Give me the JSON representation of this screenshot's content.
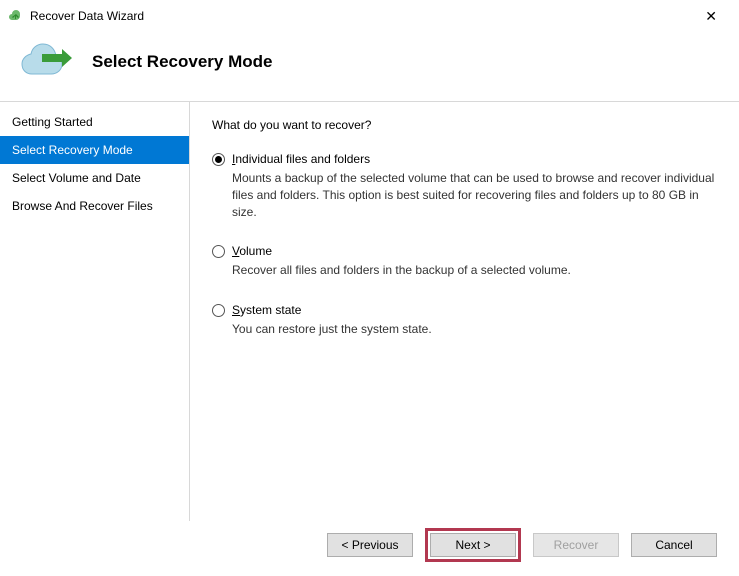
{
  "window": {
    "title": "Recover Data Wizard"
  },
  "header": {
    "title": "Select Recovery Mode"
  },
  "sidebar": {
    "items": [
      {
        "label": "Getting Started",
        "selected": false
      },
      {
        "label": "Select Recovery Mode",
        "selected": true
      },
      {
        "label": "Select Volume and Date",
        "selected": false
      },
      {
        "label": "Browse And Recover Files",
        "selected": false
      }
    ]
  },
  "content": {
    "prompt": "What do you want to recover?",
    "options": [
      {
        "label": "Individual files and folders",
        "description": "Mounts a backup of the selected volume that can be used to browse and recover individual files and folders. This option is best suited for recovering files and folders up to 80 GB in size.",
        "selected": true
      },
      {
        "label": "Volume",
        "description": "Recover all files and folders in the backup of a selected volume.",
        "selected": false
      },
      {
        "label": "System state",
        "description": "You can restore just the system state.",
        "selected": false
      }
    ]
  },
  "footer": {
    "previous": "< Previous",
    "next": "Next >",
    "recover": "Recover",
    "cancel": "Cancel"
  }
}
